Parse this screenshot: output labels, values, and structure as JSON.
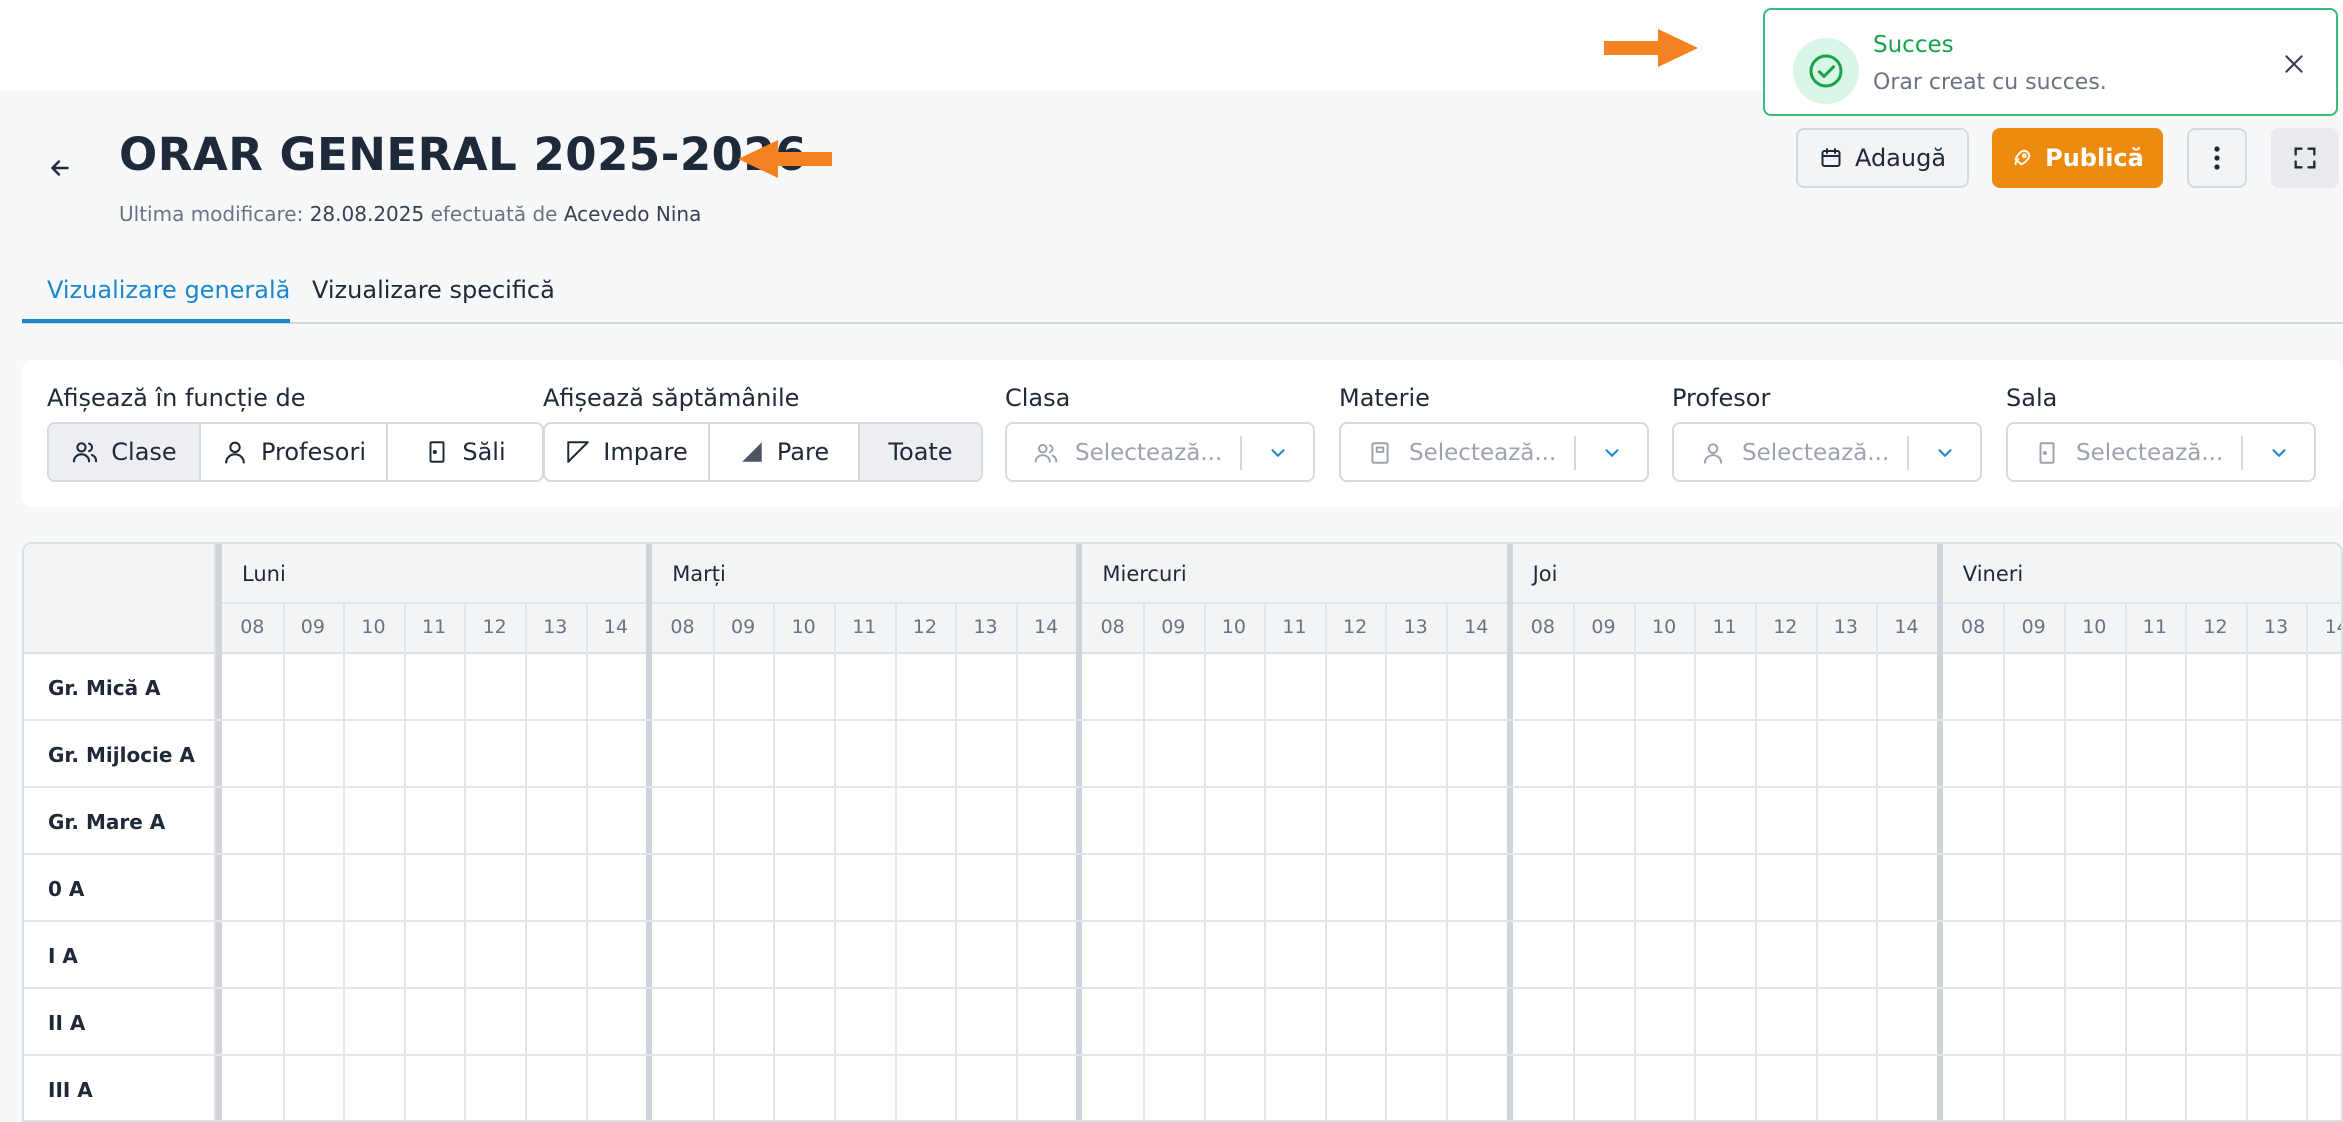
{
  "header": {
    "title": "ORAR GENERAL 2025-2026",
    "last_modified_label": "Ultima modificare:",
    "last_modified_date": "28.08.2025",
    "by_label": "efectuată de",
    "author": "Acevedo Nina"
  },
  "toast": {
    "title": "Succes",
    "message": "Orar creat cu succes."
  },
  "actions": {
    "add_label": "Adaugă",
    "publish_label": "Publică"
  },
  "tabs": [
    {
      "label": "Vizualizare generală",
      "active": true
    },
    {
      "label": "Vizualizare specifică",
      "active": false
    }
  ],
  "filters": {
    "display_by": {
      "label": "Afișează în funcție de",
      "options": [
        {
          "label": "Clase",
          "icon": "users-icon",
          "active": true
        },
        {
          "label": "Profesori",
          "icon": "user-icon",
          "active": false
        },
        {
          "label": "Săli",
          "icon": "door-icon",
          "active": false
        }
      ]
    },
    "weeks": {
      "label": "Afișează săptămânile",
      "options": [
        {
          "label": "Impare",
          "icon": "triangle-outline-icon",
          "active": false
        },
        {
          "label": "Pare",
          "icon": "triangle-filled-icon",
          "active": false
        },
        {
          "label": "Toate",
          "active": true
        }
      ]
    },
    "selects": [
      {
        "label": "Clasa",
        "placeholder": "Selectează...",
        "icon": "users-icon"
      },
      {
        "label": "Materie",
        "placeholder": "Selectează...",
        "icon": "book-icon"
      },
      {
        "label": "Profesor",
        "placeholder": "Selectează...",
        "icon": "user-icon"
      },
      {
        "label": "Sala",
        "placeholder": "Selectează...",
        "icon": "door-icon"
      }
    ]
  },
  "schedule": {
    "days": [
      "Luni",
      "Marți",
      "Miercuri",
      "Joi",
      "Vineri"
    ],
    "hours": [
      "08",
      "09",
      "10",
      "11",
      "12",
      "13",
      "14"
    ],
    "rows": [
      "Gr. Mică A",
      "Gr. Mijlocie A",
      "Gr. Mare A",
      "0 A",
      "I A",
      "II A",
      "III A"
    ]
  },
  "colors": {
    "accent_blue": "#1c87c9",
    "publish_orange": "#ed8b11",
    "success_green": "#16a34a",
    "annotation_arrow": "#f58220"
  }
}
